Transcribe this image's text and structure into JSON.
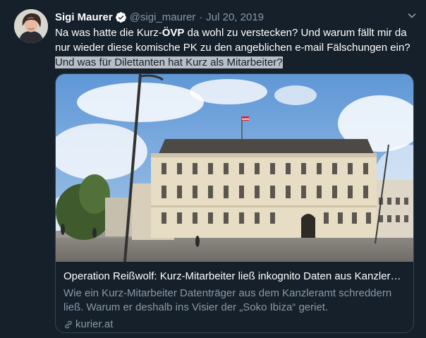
{
  "tweet": {
    "author_name": "Sigi Maurer",
    "handle": "@sigi_maurer",
    "separator": "·",
    "date": "Jul 20, 2019",
    "text_part1": "Na was hatte die Kurz-",
    "text_bold": "ÖVP",
    "text_part2": " da wohl zu verstecken? Und warum fällt mir da nur wieder diese komische PK zu den angeblichen e-mail Fälschungen ein? ",
    "text_highlighted": "Und was für Dilettanten hat Kurz als Mitarbeiter?"
  },
  "card": {
    "title": "Operation Reißwolf: Kurz-Mitarbeiter ließ inkognito Daten aus Kanzleramt schreddern",
    "description": "Wie ein Kurz-Mitarbeiter Datenträger aus dem Kanzleramt schreddern ließ. Warum er deshalb ins Visier der „Soko Ibiza“ geriet.",
    "domain": "kurier.at"
  },
  "icons": {
    "verified": "verified-badge-icon",
    "caret": "chevron-down-icon",
    "link": "link-icon"
  },
  "colors": {
    "background": "#15202b",
    "text_primary": "#ffffff",
    "text_secondary": "#8899a6",
    "verified": "#ffffff",
    "border": "#38444d",
    "highlight": "#b9bec6"
  }
}
